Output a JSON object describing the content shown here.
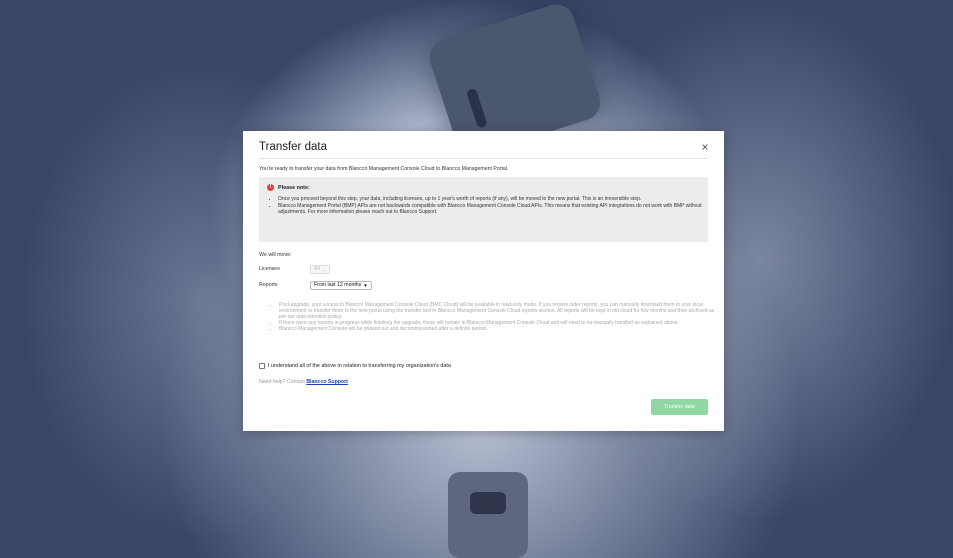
{
  "modal": {
    "title": "Transfer data",
    "close_glyph": "×",
    "intro": "You're ready to transfer your data from Blancco Management Console Cloud to Blancco Management Portal.",
    "note": {
      "icon": "warning-icon",
      "icon_glyph": "!",
      "title": "Please note:",
      "items": [
        "Once you proceed beyond this step, your data, including licenses, up to 1 year's worth of reports (if any), will be moved to the new portal. This is an irreversible step.",
        "Blancco Management Portal (BMP) APIs are not backwards compatible with Blancco Management Console Cloud APIs. This means that existing API integrations do not work with BMP without adjustments. For more information please reach out to Blancco Support."
      ]
    },
    "we_will_move": "We will move:",
    "licenses": {
      "label": "Licenses",
      "value": "All",
      "disabled": true
    },
    "reports": {
      "label": "Reports",
      "value": "From last 12 months"
    },
    "info_items": [
      "Post-upgrade, your access to Blancco Management Console Cloud (BMC Cloud) will be available in read-only mode. If you require older reports, you can manually download them to your local environment or transfer them to the new portal using the transfer tool in Blancco Management Console Cloud reports section. All reports will be kept in old cloud for few months and then archived as per our data retention policy.",
      "If there were any reports in-progress while finishing the upgrade, these will remain in Blancco Management Console Cloud and will need to be manually handled as explained above.",
      "Blancco Management Console will be phased out and decommissioned after a definite period."
    ],
    "agree_label": "I understand all of the above in relation to transferring my organization's data",
    "agree_checked": false,
    "help_text": "Need help? Contact",
    "help_link": "Blancco Support",
    "transfer_button": "Transfer data",
    "colors": {
      "button": "#90d7a3",
      "warning": "#d9453a",
      "link": "#1a3fb8",
      "note_bg": "#ececec"
    }
  }
}
